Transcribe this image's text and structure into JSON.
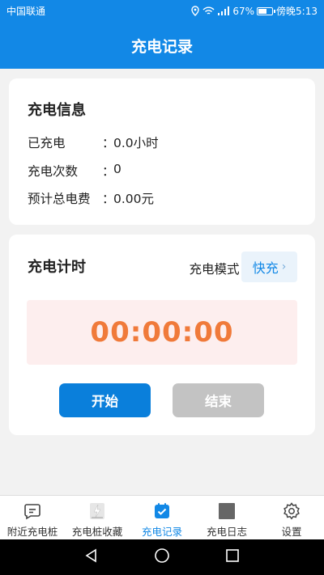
{
  "status_bar": {
    "carrier": "中国联通",
    "battery_percent": "67%",
    "battery_level": 0.67,
    "time": "傍晚5:13"
  },
  "header": {
    "title": "充电记录"
  },
  "info_card": {
    "title": "充电信息",
    "rows": [
      {
        "label": "已充电",
        "colon": "：",
        "value": "0.0小时"
      },
      {
        "label": "充电次数",
        "colon": "：",
        "value": "0"
      },
      {
        "label": "预计总电费",
        "colon": "：",
        "value": "0.00元"
      }
    ]
  },
  "timer_card": {
    "title": "充电计时",
    "mode_label": "充电模式：",
    "mode_value": "快充",
    "timer": "00:00:00",
    "start_label": "开始",
    "end_label": "结束"
  },
  "tabs": [
    {
      "label": "附近充电桩",
      "icon": "message-icon"
    },
    {
      "label": "充电桩收藏",
      "icon": "charger-icon"
    },
    {
      "label": "充电记录",
      "icon": "calendar-check-icon",
      "active": true
    },
    {
      "label": "充电日志",
      "icon": "square-icon"
    },
    {
      "label": "设置",
      "icon": "gear-icon"
    }
  ],
  "colors": {
    "primary": "#1288e6",
    "timer_text": "#f07a3a",
    "timer_bg": "#fdeeee",
    "disabled_button": "#c3c3c3"
  }
}
